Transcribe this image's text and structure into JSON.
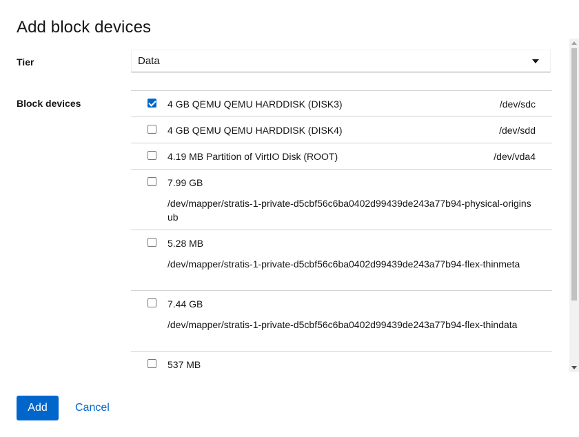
{
  "dialog": {
    "title": "Add block devices"
  },
  "tier": {
    "label": "Tier",
    "value": "Data"
  },
  "block_devices": {
    "label": "Block devices",
    "items": [
      {
        "desc": "4 GB QEMU QEMU HARDDISK (DISK3)",
        "path": "/dev/sdc",
        "checked": true
      },
      {
        "desc": "4 GB QEMU QEMU HARDDISK (DISK4)",
        "path": "/dev/sdd",
        "checked": false
      },
      {
        "desc": "4.19 MB Partition of VirtIO Disk (ROOT)",
        "path": "/dev/vda4",
        "checked": false
      },
      {
        "desc": "7.99 GB",
        "path": "/dev/mapper/stratis-1-private-d5cbf56c6ba0402d99439de243a77b94-physical-originsub",
        "checked": false
      },
      {
        "desc": "5.28 MB",
        "path": "/dev/mapper/stratis-1-private-d5cbf56c6ba0402d99439de243a77b94-flex-thinmeta",
        "checked": false
      },
      {
        "desc": "7.44 GB",
        "path": "/dev/mapper/stratis-1-private-d5cbf56c6ba0402d99439de243a77b94-flex-thindata",
        "checked": false
      },
      {
        "desc": "537 MB",
        "path": "",
        "checked": false
      }
    ]
  },
  "footer": {
    "add_label": "Add",
    "cancel_label": "Cancel"
  },
  "colors": {
    "primary": "#0066cc",
    "text": "#151515",
    "border": "#d2d2d2"
  }
}
